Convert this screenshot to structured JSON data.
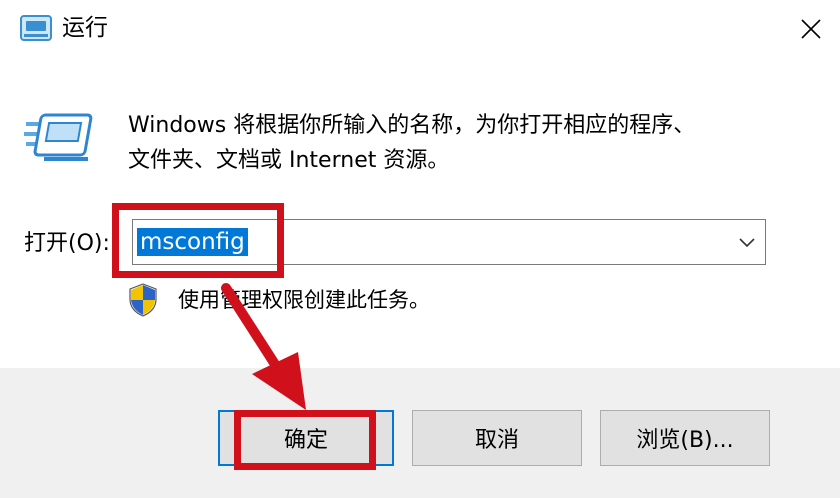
{
  "window": {
    "title": "运行",
    "title_icon": "run-app-icon",
    "close_icon": "close-icon"
  },
  "body": {
    "description_line1": "Windows 将根据你所输入的名称，为你打开相应的程序、",
    "description_line2": "文件夹、文档或 Internet 资源。",
    "open_label": "打开(O):",
    "open_value": "msconfig",
    "admin_note": "使用管理权限创建此任务。"
  },
  "buttons": {
    "ok": "确定",
    "cancel": "取消",
    "browse": "浏览(B)..."
  },
  "colors": {
    "selection": "#0078d7",
    "annotation": "#d0111b",
    "footer_bg": "#f0f0f0"
  }
}
